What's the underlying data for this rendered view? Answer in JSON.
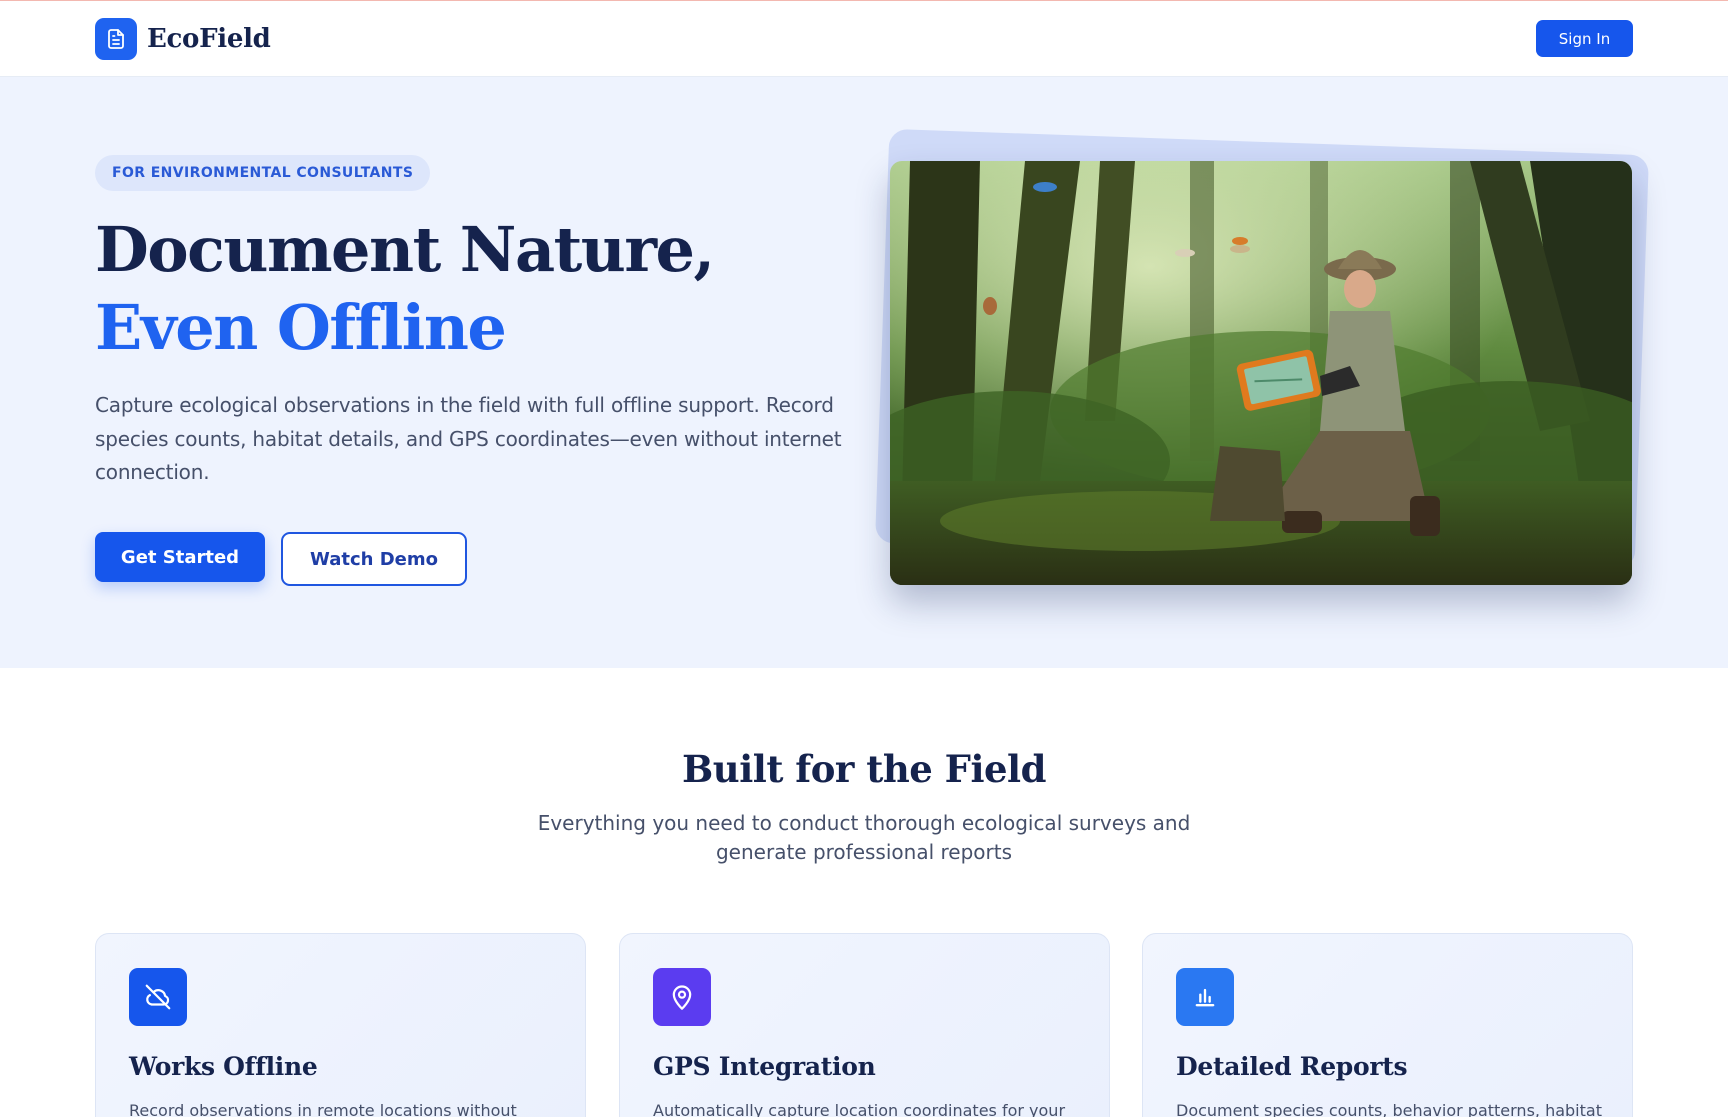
{
  "nav": {
    "brand_name": "EcoField",
    "brand_icon": "document-icon",
    "signin_label": "Sign In"
  },
  "hero": {
    "badge": "FOR ENVIRONMENTAL CONSULTANTS",
    "title_line1": "Document Nature,",
    "title_line2": "Even Offline",
    "description": "Capture ecological observations in the field with full offline support. Record species counts, habitat details, and GPS coordinates—even without internet connection.",
    "primary_button": "Get Started",
    "secondary_button": "Watch Demo"
  },
  "features": {
    "title": "Built for the Field",
    "subtitle": "Everything you need to conduct thorough ecological surveys and generate professional reports",
    "cards": [
      {
        "icon": "cloud-off-icon",
        "title": "Works Offline",
        "text": "Record observations in remote locations without",
        "color": "#1656ec"
      },
      {
        "icon": "map-pin-icon",
        "title": "GPS Integration",
        "text": "Automatically capture location coordinates for your",
        "color": "#5b3cf0"
      },
      {
        "icon": "bar-chart-icon",
        "title": "Detailed Reports",
        "text": "Document species counts, behavior patterns, habitat",
        "color": "#2a78f2"
      }
    ]
  },
  "colors": {
    "accent": "#1f63f0",
    "primary_button": "#1656ec",
    "heading": "#15234d",
    "hero_background": "#eef3fe"
  }
}
